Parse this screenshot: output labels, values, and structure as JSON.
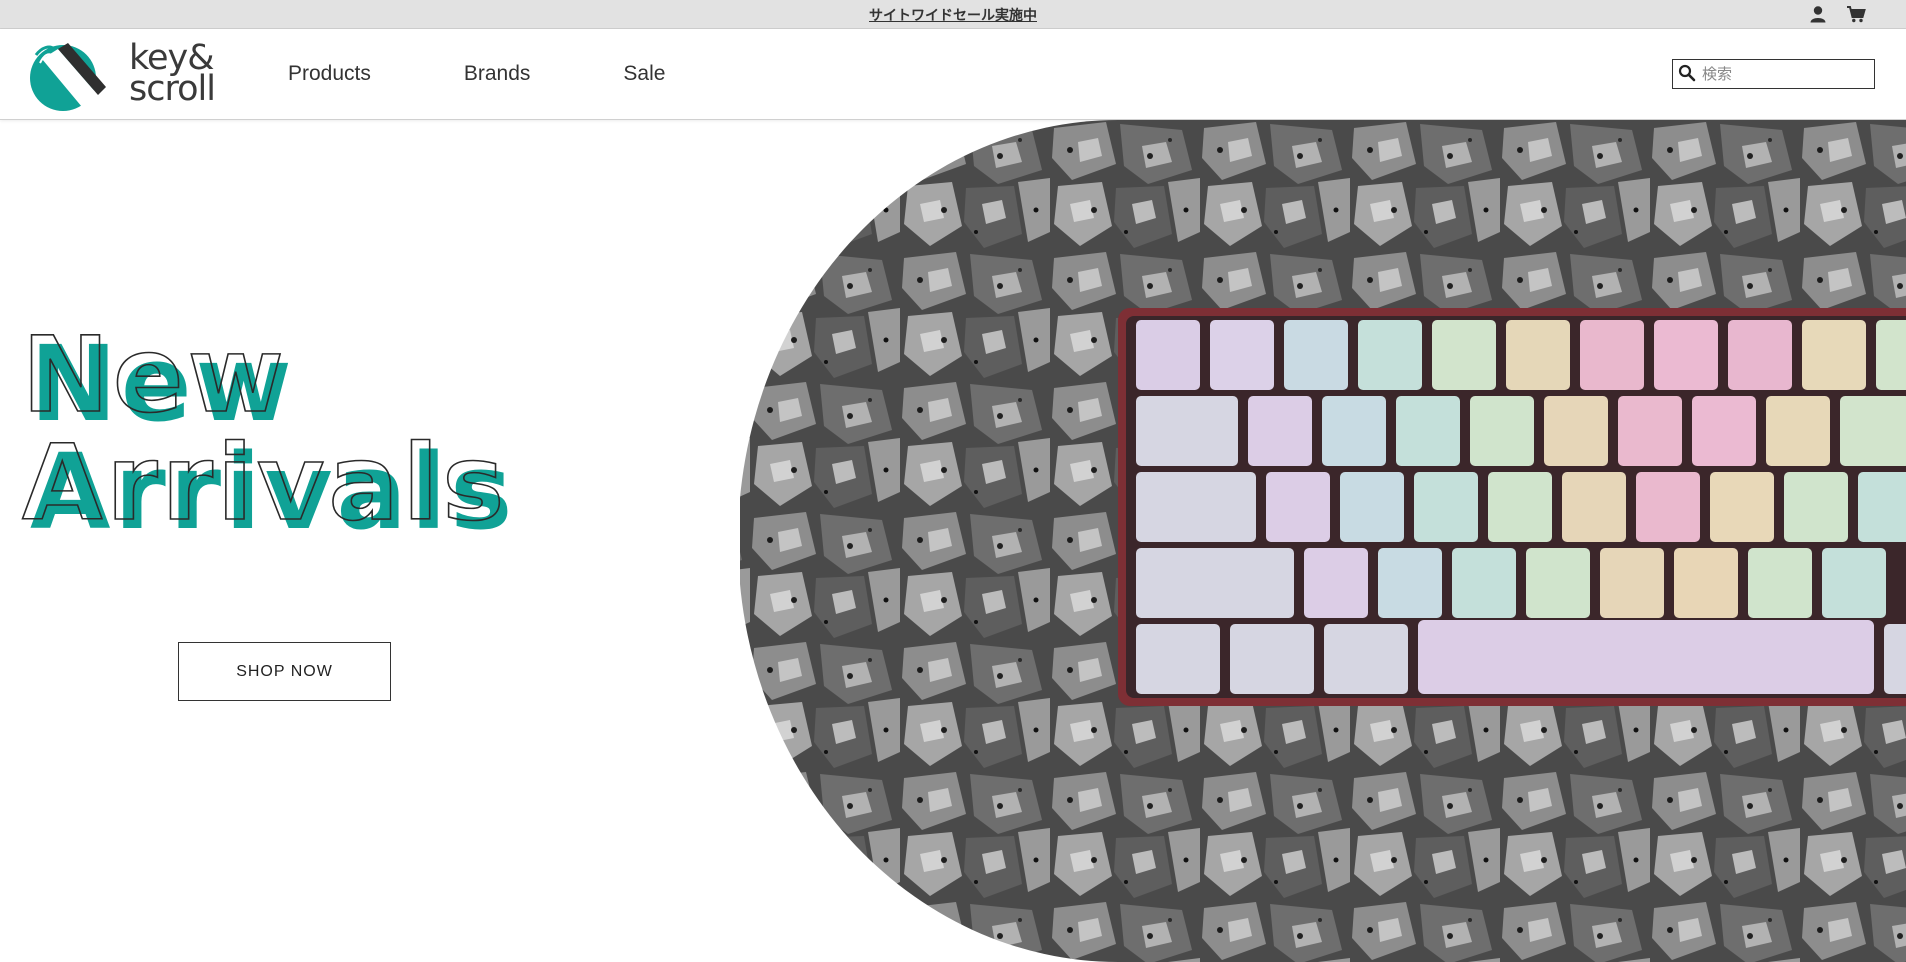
{
  "announcement": {
    "text": "サイトワイドセール実施中"
  },
  "logo": {
    "line1": "key&",
    "line2": "scroll"
  },
  "nav": {
    "items": [
      "Products",
      "Brands",
      "Sale"
    ]
  },
  "search": {
    "placeholder": "検索",
    "value": ""
  },
  "hero": {
    "headline_line1": "New",
    "headline_line2": "Arrivals",
    "cta_label": "SHOP NOW"
  },
  "colors": {
    "accent": "#10a296",
    "announce_bg": "#e2e2e2",
    "text": "#333333"
  },
  "icons": [
    "account-icon",
    "cart-icon",
    "search-icon",
    "logo-mark"
  ]
}
